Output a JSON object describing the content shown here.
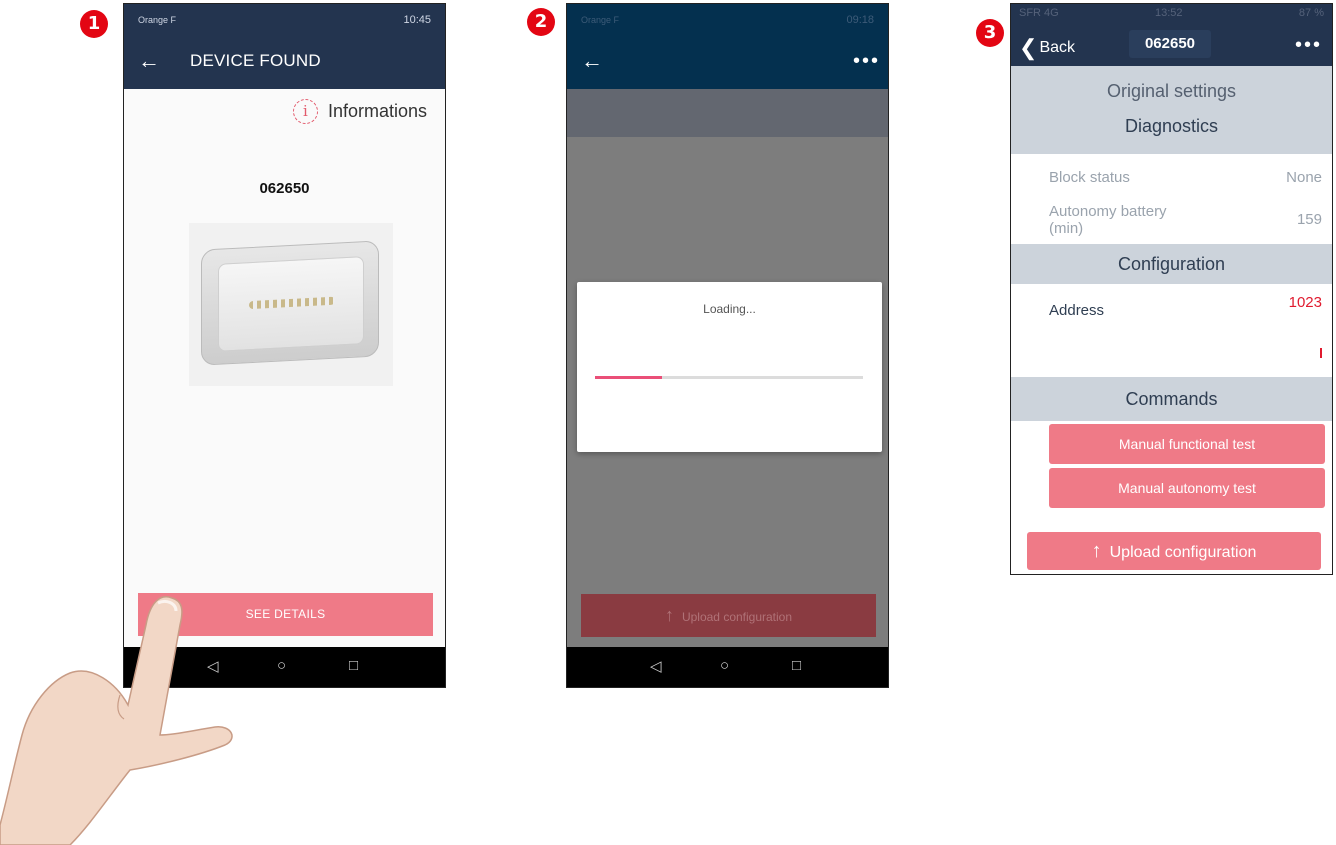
{
  "badges": [
    "1",
    "2",
    "3"
  ],
  "phone1": {
    "status_left": "Orange F",
    "status_right": "10:45",
    "back_icon": "arrow-left-icon",
    "title": "DEVICE FOUND",
    "info_label": "Informations",
    "info_icon_glyph": "i",
    "device_code": "062650",
    "see_details": "SEE DETAILS",
    "nav": [
      "◁",
      "○",
      "□"
    ]
  },
  "phone2": {
    "status_left": "Orange F",
    "status_right": "09:18",
    "dots": "•••",
    "loading": "Loading...",
    "progress": 0.25,
    "upload_label": "Upload configuration",
    "nav": [
      "◁",
      "○",
      "□"
    ]
  },
  "phone3": {
    "status_left": "SFR  4G",
    "status_time": "13:52",
    "status_right": "87 %",
    "back_label": "Back",
    "title": "062650",
    "dots": "•••",
    "original_settings": "Original settings",
    "diagnostics": "Diagnostics",
    "block_status_label": "Block status",
    "block_status_value": "None",
    "autonomy_label_1": "Autonomy battery",
    "autonomy_label_2": "(min)",
    "autonomy_value": "159",
    "configuration": "Configuration",
    "address_label": "Address",
    "address_value": "1023",
    "commands": "Commands",
    "manual_functional_test": "Manual functional test",
    "manual_autonomy_test": "Manual autonomy test",
    "upload_configuration": "Upload configuration"
  },
  "colors": {
    "navy": "#23344f",
    "pink": "#ef7a87",
    "badge_red": "#e30613",
    "section_grey": "#ccd3db"
  }
}
